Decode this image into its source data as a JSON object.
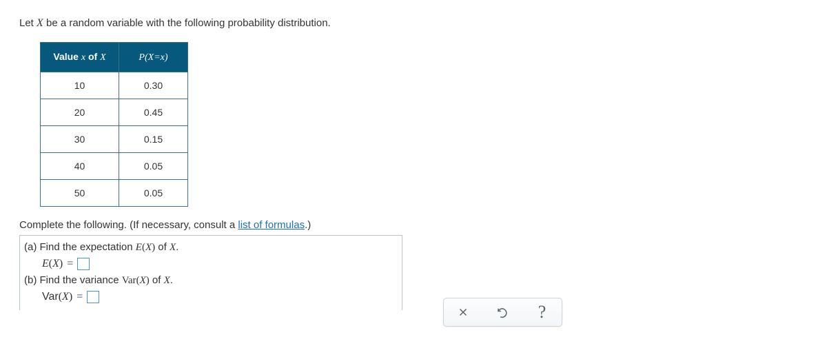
{
  "intro": {
    "prefix": "Let ",
    "var": "X",
    "suffix": " be a random variable with the following probability distribution."
  },
  "table": {
    "header": {
      "value_prefix": "Value ",
      "value_var": "x",
      "value_of": " of ",
      "value_bigvar": "X",
      "prob_P": "P",
      "prob_open": "(",
      "prob_bigX": "X",
      "prob_eq": "=",
      "prob_x": "x",
      "prob_close": ")"
    },
    "rows": [
      {
        "x": "10",
        "p": "0.30"
      },
      {
        "x": "20",
        "p": "0.45"
      },
      {
        "x": "30",
        "p": "0.15"
      },
      {
        "x": "40",
        "p": "0.05"
      },
      {
        "x": "50",
        "p": "0.05"
      }
    ]
  },
  "instruction": {
    "prefix": "Complete the following. (If necessary, consult a ",
    "link": "list of formulas",
    "suffix": ".)"
  },
  "part_a": {
    "label_prefix": "(a) Find the expectation ",
    "label_E": "E",
    "label_open": "(",
    "label_X": "X",
    "label_close": ")",
    "label_of": " of ",
    "label_var": "X",
    "label_end": ".",
    "eq_E": "E",
    "eq_open": "(",
    "eq_X": "X",
    "eq_close": ")",
    "eq_sign": "="
  },
  "part_b": {
    "label_prefix": "(b) Find the variance ",
    "label_Var": "Var",
    "label_open": "(",
    "label_X": "X",
    "label_close": ")",
    "label_of": " of ",
    "label_var": "X",
    "label_end": ".",
    "eq_Var": "Var",
    "eq_open": "(",
    "eq_X": "X",
    "eq_close": ")",
    "eq_sign": "="
  }
}
